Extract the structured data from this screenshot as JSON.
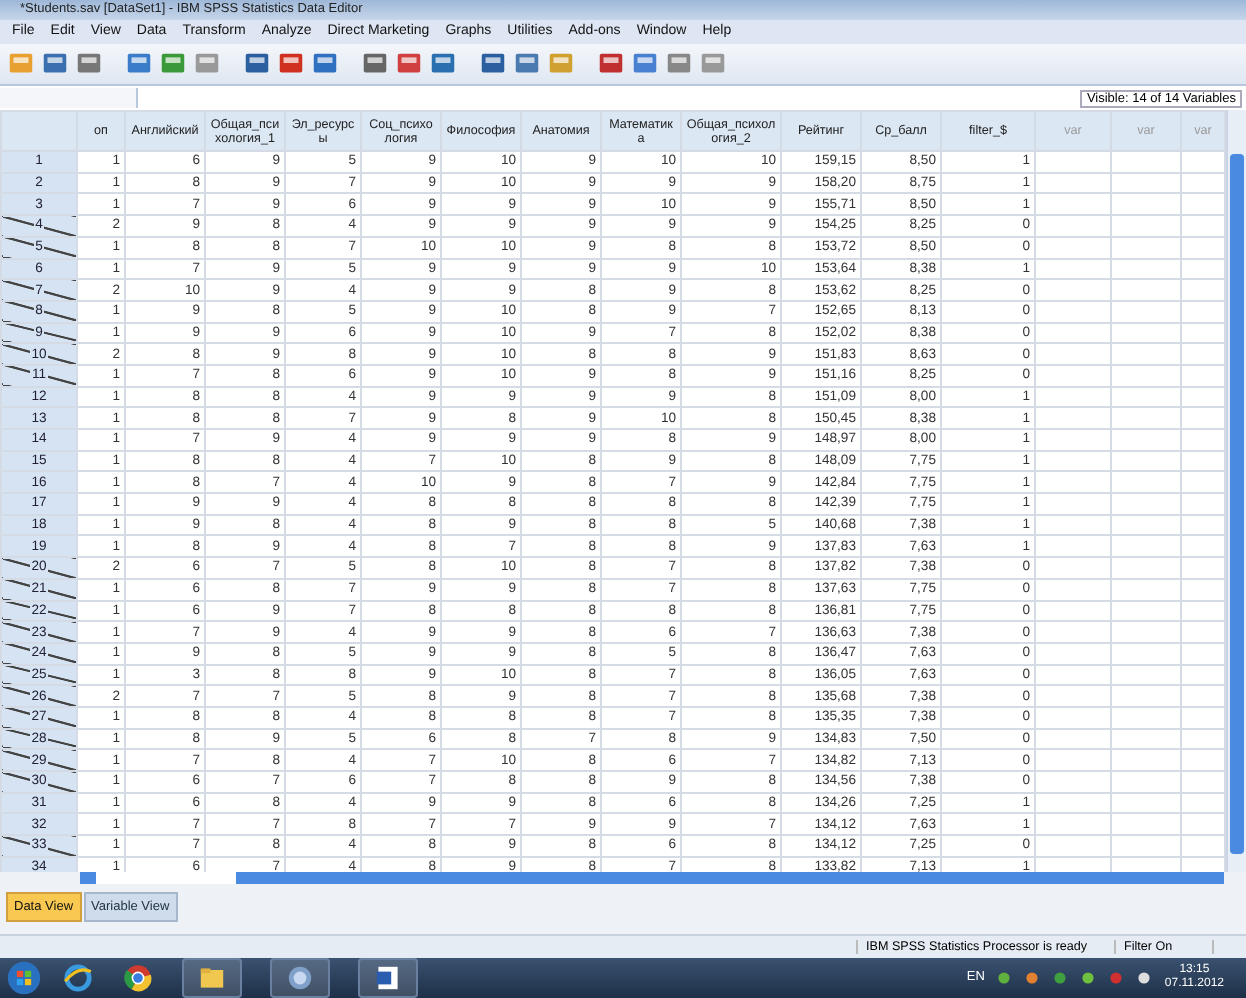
{
  "window": {
    "title": "*Students.sav [DataSet1] - IBM SPSS Statistics Data Editor"
  },
  "menu": [
    "File",
    "Edit",
    "View",
    "Data",
    "Transform",
    "Analyze",
    "Direct Marketing",
    "Graphs",
    "Utilities",
    "Add-ons",
    "Window",
    "Help"
  ],
  "visible_info": "Visible: 14 of 14 Variables",
  "columns": [
    {
      "label": "оп",
      "kind": "data"
    },
    {
      "label": "Английский",
      "kind": "data"
    },
    {
      "label": "Общая_психология_1",
      "kind": "data"
    },
    {
      "label": "Эл_ресурсы",
      "kind": "data"
    },
    {
      "label": "Соц_психология",
      "kind": "data"
    },
    {
      "label": "Философия",
      "kind": "data"
    },
    {
      "label": "Анатомия",
      "kind": "data"
    },
    {
      "label": "Математика",
      "kind": "data"
    },
    {
      "label": "Общая_психология_2",
      "kind": "data"
    },
    {
      "label": "Рейтинг",
      "kind": "data"
    },
    {
      "label": "Ср_балл",
      "kind": "data"
    },
    {
      "label": "filter_$",
      "kind": "data"
    },
    {
      "label": "var",
      "kind": "empty"
    },
    {
      "label": "var",
      "kind": "empty"
    },
    {
      "label": "var",
      "kind": "empty"
    }
  ],
  "rows": [
    {
      "number": "1",
      "excluded": false,
      "cells": [
        "1",
        "6",
        "9",
        "5",
        "9",
        "10",
        "9",
        "10",
        "10",
        "159,15",
        "8,50",
        "1"
      ]
    },
    {
      "number": "2",
      "excluded": false,
      "cells": [
        "1",
        "8",
        "9",
        "7",
        "9",
        "10",
        "9",
        "9",
        "9",
        "158,20",
        "8,75",
        "1"
      ]
    },
    {
      "number": "3",
      "excluded": false,
      "cells": [
        "1",
        "7",
        "9",
        "6",
        "9",
        "9",
        "9",
        "10",
        "9",
        "155,71",
        "8,50",
        "1"
      ]
    },
    {
      "number": "4",
      "excluded": true,
      "cells": [
        "2",
        "9",
        "8",
        "4",
        "9",
        "9",
        "9",
        "9",
        "9",
        "154,25",
        "8,25",
        "0"
      ]
    },
    {
      "number": "5",
      "excluded": true,
      "cells": [
        "1",
        "8",
        "8",
        "7",
        "10",
        "10",
        "9",
        "8",
        "8",
        "153,72",
        "8,50",
        "0"
      ]
    },
    {
      "number": "6",
      "excluded": false,
      "cells": [
        "1",
        "7",
        "9",
        "5",
        "9",
        "9",
        "9",
        "9",
        "10",
        "153,64",
        "8,38",
        "1"
      ]
    },
    {
      "number": "7",
      "excluded": true,
      "cells": [
        "2",
        "10",
        "9",
        "4",
        "9",
        "9",
        "8",
        "9",
        "8",
        "153,62",
        "8,25",
        "0"
      ]
    },
    {
      "number": "8",
      "excluded": true,
      "cells": [
        "1",
        "9",
        "8",
        "5",
        "9",
        "10",
        "8",
        "9",
        "7",
        "152,65",
        "8,13",
        "0"
      ]
    },
    {
      "number": "9",
      "excluded": true,
      "cells": [
        "1",
        "9",
        "9",
        "6",
        "9",
        "10",
        "9",
        "7",
        "8",
        "152,02",
        "8,38",
        "0"
      ]
    },
    {
      "number": "10",
      "excluded": true,
      "cells": [
        "2",
        "8",
        "9",
        "8",
        "9",
        "10",
        "8",
        "8",
        "9",
        "151,83",
        "8,63",
        "0"
      ]
    },
    {
      "number": "11",
      "excluded": true,
      "cells": [
        "1",
        "7",
        "8",
        "6",
        "9",
        "10",
        "9",
        "8",
        "9",
        "151,16",
        "8,25",
        "0"
      ]
    },
    {
      "number": "12",
      "excluded": false,
      "cells": [
        "1",
        "8",
        "8",
        "4",
        "9",
        "9",
        "9",
        "9",
        "8",
        "151,09",
        "8,00",
        "1"
      ]
    },
    {
      "number": "13",
      "excluded": false,
      "cells": [
        "1",
        "8",
        "8",
        "7",
        "9",
        "8",
        "9",
        "10",
        "8",
        "150,45",
        "8,38",
        "1"
      ]
    },
    {
      "number": "14",
      "excluded": false,
      "cells": [
        "1",
        "7",
        "9",
        "4",
        "9",
        "9",
        "9",
        "8",
        "9",
        "148,97",
        "8,00",
        "1"
      ]
    },
    {
      "number": "15",
      "excluded": false,
      "cells": [
        "1",
        "8",
        "8",
        "4",
        "7",
        "10",
        "8",
        "9",
        "8",
        "148,09",
        "7,75",
        "1"
      ]
    },
    {
      "number": "16",
      "excluded": false,
      "cells": [
        "1",
        "8",
        "7",
        "4",
        "10",
        "9",
        "8",
        "7",
        "9",
        "142,84",
        "7,75",
        "1"
      ]
    },
    {
      "number": "17",
      "excluded": false,
      "cells": [
        "1",
        "9",
        "9",
        "4",
        "8",
        "8",
        "8",
        "8",
        "8",
        "142,39",
        "7,75",
        "1"
      ]
    },
    {
      "number": "18",
      "excluded": false,
      "cells": [
        "1",
        "9",
        "8",
        "4",
        "8",
        "9",
        "8",
        "8",
        "5",
        "140,68",
        "7,38",
        "1"
      ]
    },
    {
      "number": "19",
      "excluded": false,
      "cells": [
        "1",
        "8",
        "9",
        "4",
        "8",
        "7",
        "8",
        "8",
        "9",
        "137,83",
        "7,63",
        "1"
      ]
    },
    {
      "number": "20",
      "excluded": true,
      "cells": [
        "2",
        "6",
        "7",
        "5",
        "8",
        "10",
        "8",
        "7",
        "8",
        "137,82",
        "7,38",
        "0"
      ]
    },
    {
      "number": "21",
      "excluded": true,
      "cells": [
        "1",
        "6",
        "8",
        "7",
        "9",
        "9",
        "8",
        "7",
        "8",
        "137,63",
        "7,75",
        "0"
      ]
    },
    {
      "number": "22",
      "excluded": true,
      "cells": [
        "1",
        "6",
        "9",
        "7",
        "8",
        "8",
        "8",
        "8",
        "8",
        "136,81",
        "7,75",
        "0"
      ]
    },
    {
      "number": "23",
      "excluded": true,
      "cells": [
        "1",
        "7",
        "9",
        "4",
        "9",
        "9",
        "8",
        "6",
        "7",
        "136,63",
        "7,38",
        "0"
      ]
    },
    {
      "number": "24",
      "excluded": true,
      "cells": [
        "1",
        "9",
        "8",
        "5",
        "9",
        "9",
        "8",
        "5",
        "8",
        "136,47",
        "7,63",
        "0"
      ]
    },
    {
      "number": "25",
      "excluded": true,
      "cells": [
        "1",
        "3",
        "8",
        "8",
        "9",
        "10",
        "8",
        "7",
        "8",
        "136,05",
        "7,63",
        "0"
      ]
    },
    {
      "number": "26",
      "excluded": true,
      "cells": [
        "2",
        "7",
        "7",
        "5",
        "8",
        "9",
        "8",
        "7",
        "8",
        "135,68",
        "7,38",
        "0"
      ]
    },
    {
      "number": "27",
      "excluded": true,
      "cells": [
        "1",
        "8",
        "8",
        "4",
        "8",
        "8",
        "8",
        "7",
        "8",
        "135,35",
        "7,38",
        "0"
      ]
    },
    {
      "number": "28",
      "excluded": true,
      "cells": [
        "1",
        "8",
        "9",
        "5",
        "6",
        "8",
        "7",
        "8",
        "9",
        "134,83",
        "7,50",
        "0"
      ]
    },
    {
      "number": "29",
      "excluded": true,
      "cells": [
        "1",
        "7",
        "8",
        "4",
        "7",
        "10",
        "8",
        "6",
        "7",
        "134,82",
        "7,13",
        "0"
      ]
    },
    {
      "number": "30",
      "excluded": true,
      "cells": [
        "1",
        "6",
        "7",
        "6",
        "7",
        "8",
        "8",
        "9",
        "8",
        "134,56",
        "7,38",
        "0"
      ]
    },
    {
      "number": "31",
      "excluded": false,
      "cells": [
        "1",
        "6",
        "8",
        "4",
        "9",
        "9",
        "8",
        "6",
        "8",
        "134,26",
        "7,25",
        "1"
      ]
    },
    {
      "number": "32",
      "excluded": false,
      "cells": [
        "1",
        "7",
        "7",
        "8",
        "7",
        "7",
        "9",
        "9",
        "7",
        "134,12",
        "7,63",
        "1"
      ]
    },
    {
      "number": "33",
      "excluded": true,
      "cells": [
        "1",
        "7",
        "8",
        "4",
        "8",
        "9",
        "8",
        "6",
        "8",
        "134,12",
        "7,25",
        "0"
      ]
    },
    {
      "number": "34",
      "excluded": false,
      "cells": [
        "1",
        "6",
        "7",
        "4",
        "8",
        "9",
        "8",
        "7",
        "8",
        "133,82",
        "7,13",
        "1"
      ]
    }
  ],
  "view_tabs": [
    {
      "label": "Data View",
      "selected": true
    },
    {
      "label": "Variable View",
      "selected": false
    }
  ],
  "status_bar": {
    "processor": "IBM SPSS Statistics Processor is ready",
    "filter": "Filter On"
  },
  "taskbar": {
    "language": "EN",
    "time": "13:15",
    "date": "07.11.2012"
  }
}
